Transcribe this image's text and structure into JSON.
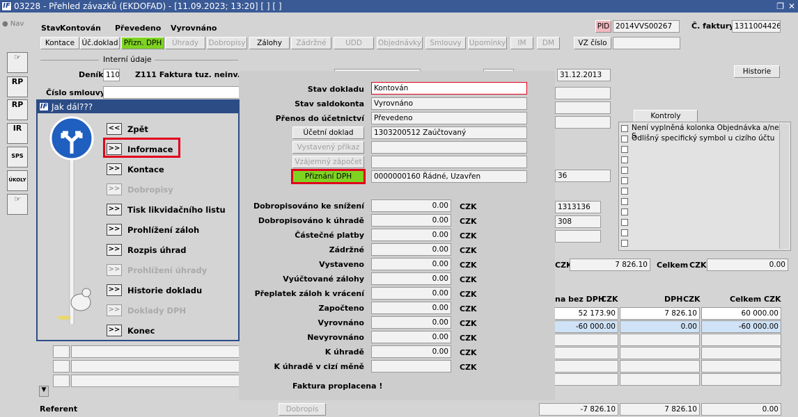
{
  "window": {
    "title": "03228 - Přehled závazků (EKDOFAD) - [11.09.2023; 13:20]  [ ]  [ ]",
    "logo": "IF"
  },
  "nav": {
    "label": "Nav"
  },
  "status": {
    "stav_label": "Stav",
    "stav_value": "Kontován",
    "prevedeno": "Převedeno",
    "vyrovnano": "Vyrovnáno"
  },
  "toolbar": {
    "buttons": [
      "Kontace",
      "Úč.doklad",
      "Přizn. DPH",
      "Úhrady",
      "Dobropisy",
      "Zálohy",
      "Zádržné",
      "UDD",
      "Objednávky",
      "Smlouvy",
      "Upomínky",
      "IM",
      "DM"
    ],
    "vz_cislo": "VZ číslo"
  },
  "pid": {
    "label": "PID",
    "value": "2014VVS00267"
  },
  "faktura": {
    "label": "Č. faktury",
    "value": "1311004426"
  },
  "form": {
    "interni": "Interní údaje",
    "denik_label": "Deník",
    "denik_value": "110",
    "z111": "Z111 Faktura tuz. neinv.",
    "date": "31.12.2013",
    "cislo_smlouvy": "Číslo smlouvy",
    "referent": "Referent",
    "historie": "Historie",
    "kontroly": "Kontroly",
    "cz1": "CZK",
    "celkem": "Celkem",
    "czk": "CZK",
    "amount1": "7 826.10",
    "amount2": "0.00",
    "val36": "36",
    "v1313136": "1313136",
    "v308": "308"
  },
  "kontroly_list": [
    "Není vyplněná kolonka Objednávka a/nebo S",
    "Odlišný specifický symbol u cizího účtu"
  ],
  "table": {
    "col1": "na bez DPH",
    "col1c": "CZK",
    "col2": "DPH",
    "col2c": "CZK",
    "col3": "Celkem",
    "col3c": "CZK",
    "rows": [
      [
        "52 173.90",
        "7 826.10",
        "60 000.00"
      ],
      [
        "-60 000.00",
        "0.00",
        "-60 000.00"
      ]
    ],
    "totals": [
      "-7 826.10",
      "7 826.10",
      "0.00"
    ],
    "dobropis": "Dobropis"
  },
  "sidebar": {
    "icons": [
      "RP",
      "RP",
      "IR",
      "SPS",
      "ÚKOLY"
    ]
  },
  "jak": {
    "title": "Jak dál???",
    "items": [
      {
        "btn": "<<",
        "label": "Zpět",
        "enabled": true
      },
      {
        "btn": ">>",
        "label": "Informace",
        "enabled": true
      },
      {
        "btn": ">>",
        "label": "Kontace",
        "enabled": true
      },
      {
        "btn": ">>",
        "label": "Dobropisy",
        "enabled": false
      },
      {
        "btn": ">>",
        "label": "Tisk likvidačního listu",
        "enabled": true
      },
      {
        "btn": ">>",
        "label": "Prohlížení záloh",
        "enabled": true
      },
      {
        "btn": ">>",
        "label": "Rozpis úhrad",
        "enabled": true
      },
      {
        "btn": ">>",
        "label": "Prohlížení úhrady",
        "enabled": false
      },
      {
        "btn": ">>",
        "label": "Historie dokladu",
        "enabled": true
      },
      {
        "btn": ">>",
        "label": "Doklady DPH",
        "enabled": false
      },
      {
        "btn": ">>",
        "label": "Konec",
        "enabled": true
      }
    ]
  },
  "info": {
    "top": [
      {
        "label": "Stav dokladu",
        "value": "Kontován"
      },
      {
        "label": "Stav saldokonta",
        "value": "Vyrovnáno"
      },
      {
        "label": "Přenos do účetnictví",
        "value": "Převedeno"
      },
      {
        "label": "Účetní doklad",
        "value": "1303200512 Zaúčtovaný"
      },
      {
        "label": "Vystavený příkaz",
        "value": ""
      },
      {
        "label": "Vzájemný zápočet",
        "value": ""
      },
      {
        "label": "Přiznání DPH",
        "value": "0000000160 Řádné, Uzavřen"
      }
    ],
    "amounts": [
      {
        "label": "Dobropisováno ke snížení",
        "value": "0.00",
        "cur": "CZK"
      },
      {
        "label": "Dobropisováno k úhradě",
        "value": "0.00",
        "cur": "CZK"
      },
      {
        "label": "Částečné platby",
        "value": "0.00",
        "cur": "CZK"
      },
      {
        "label": "Zádržné",
        "value": "0.00",
        "cur": "CZK"
      },
      {
        "label": "Vystaveno",
        "value": "0.00",
        "cur": "CZK"
      },
      {
        "label": "Vyúčtované zálohy",
        "value": "0.00",
        "cur": "CZK"
      },
      {
        "label": "Přeplatek záloh k vrácení",
        "value": "0.00",
        "cur": "CZK"
      },
      {
        "label": "Započteno",
        "value": "0.00",
        "cur": "CZK"
      },
      {
        "label": "Vyrovnáno",
        "value": "0.00",
        "cur": "CZK"
      },
      {
        "label": "Nevyrovnáno",
        "value": "0.00",
        "cur": "CZK"
      },
      {
        "label": "K úhradě",
        "value": "0.00",
        "cur": "CZK"
      },
      {
        "label": "K úhradě v cizí měně",
        "value": "",
        "cur": "CZK"
      }
    ],
    "footer": "Faktura proplacena !"
  },
  "colors": {
    "titlebar": "#3a5a96",
    "green": "#7ed321",
    "red": "#e0001a",
    "pid": "#f0b8c0"
  }
}
